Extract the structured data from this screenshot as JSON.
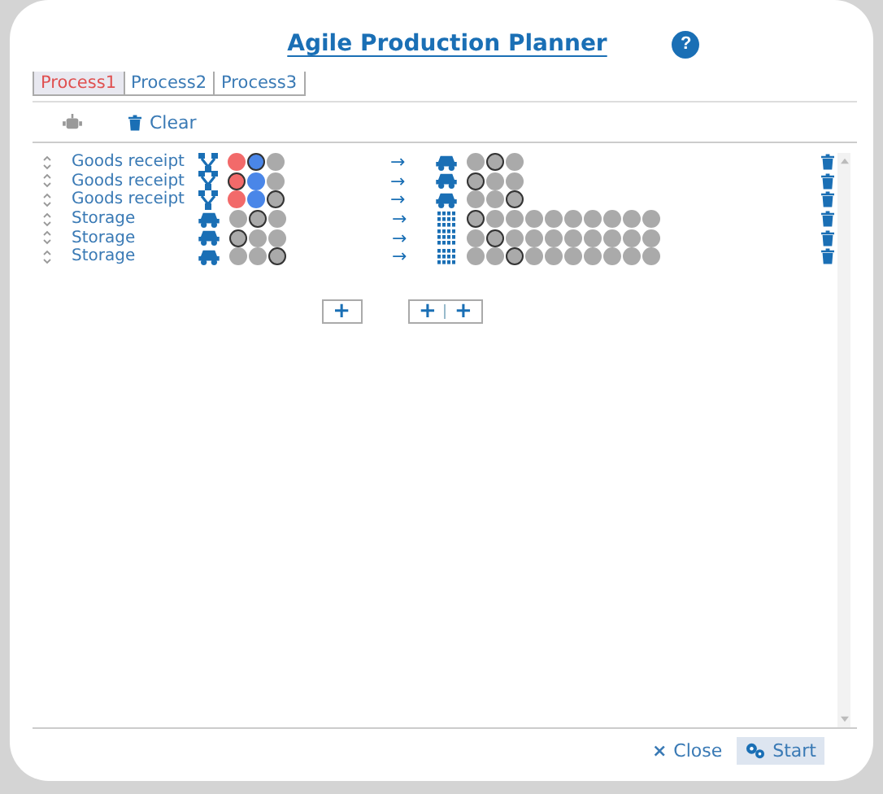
{
  "title": "Agile Production Planner",
  "help": "?",
  "tabs": [
    {
      "label": "Process1",
      "selected": true
    },
    {
      "label": "Process2",
      "selected": false
    },
    {
      "label": "Process3",
      "selected": false
    }
  ],
  "toolbar": {
    "clear": "Clear"
  },
  "rows": [
    {
      "name": "Goods receipt",
      "source": {
        "kind": "fork",
        "slots": [
          {
            "color": "#f26a6a",
            "selected": false
          },
          {
            "color": "#4a86e8",
            "selected": true
          },
          {
            "color": "#aaaaaa",
            "selected": false
          }
        ]
      },
      "arrow": "→",
      "target": {
        "kind": "car",
        "slots": [
          {
            "color": "#aaaaaa",
            "selected": false
          },
          {
            "color": "#aaaaaa",
            "selected": true
          },
          {
            "color": "#aaaaaa",
            "selected": false
          }
        ]
      }
    },
    {
      "name": "Goods receipt",
      "source": {
        "kind": "fork",
        "slots": [
          {
            "color": "#f26a6a",
            "selected": true
          },
          {
            "color": "#4a86e8",
            "selected": false
          },
          {
            "color": "#aaaaaa",
            "selected": false
          }
        ]
      },
      "arrow": "→",
      "target": {
        "kind": "car",
        "slots": [
          {
            "color": "#aaaaaa",
            "selected": true
          },
          {
            "color": "#aaaaaa",
            "selected": false
          },
          {
            "color": "#aaaaaa",
            "selected": false
          }
        ]
      }
    },
    {
      "name": "Goods receipt",
      "source": {
        "kind": "fork",
        "slots": [
          {
            "color": "#f26a6a",
            "selected": false
          },
          {
            "color": "#4a86e8",
            "selected": false
          },
          {
            "color": "#aaaaaa",
            "selected": true
          }
        ]
      },
      "arrow": "→",
      "target": {
        "kind": "car",
        "slots": [
          {
            "color": "#aaaaaa",
            "selected": false
          },
          {
            "color": "#aaaaaa",
            "selected": false
          },
          {
            "color": "#aaaaaa",
            "selected": true
          }
        ]
      }
    },
    {
      "name": "Storage",
      "source": {
        "kind": "car",
        "slots": [
          {
            "color": "#aaaaaa",
            "selected": false
          },
          {
            "color": "#aaaaaa",
            "selected": true
          },
          {
            "color": "#aaaaaa",
            "selected": false
          }
        ]
      },
      "arrow": "→",
      "target": {
        "kind": "grid",
        "slots": [
          {
            "color": "#aaaaaa",
            "selected": true
          },
          {
            "color": "#aaaaaa",
            "selected": false
          },
          {
            "color": "#aaaaaa",
            "selected": false
          },
          {
            "color": "#aaaaaa",
            "selected": false
          },
          {
            "color": "#aaaaaa",
            "selected": false
          },
          {
            "color": "#aaaaaa",
            "selected": false
          },
          {
            "color": "#aaaaaa",
            "selected": false
          },
          {
            "color": "#aaaaaa",
            "selected": false
          },
          {
            "color": "#aaaaaa",
            "selected": false
          },
          {
            "color": "#aaaaaa",
            "selected": false
          }
        ]
      }
    },
    {
      "name": "Storage",
      "source": {
        "kind": "car",
        "slots": [
          {
            "color": "#aaaaaa",
            "selected": true
          },
          {
            "color": "#aaaaaa",
            "selected": false
          },
          {
            "color": "#aaaaaa",
            "selected": false
          }
        ]
      },
      "arrow": "→",
      "target": {
        "kind": "grid",
        "slots": [
          {
            "color": "#aaaaaa",
            "selected": false
          },
          {
            "color": "#aaaaaa",
            "selected": true
          },
          {
            "color": "#aaaaaa",
            "selected": false
          },
          {
            "color": "#aaaaaa",
            "selected": false
          },
          {
            "color": "#aaaaaa",
            "selected": false
          },
          {
            "color": "#aaaaaa",
            "selected": false
          },
          {
            "color": "#aaaaaa",
            "selected": false
          },
          {
            "color": "#aaaaaa",
            "selected": false
          },
          {
            "color": "#aaaaaa",
            "selected": false
          },
          {
            "color": "#aaaaaa",
            "selected": false
          }
        ]
      }
    },
    {
      "name": "Storage",
      "source": {
        "kind": "car",
        "slots": [
          {
            "color": "#aaaaaa",
            "selected": false
          },
          {
            "color": "#aaaaaa",
            "selected": false
          },
          {
            "color": "#aaaaaa",
            "selected": true
          }
        ]
      },
      "arrow": "→",
      "target": {
        "kind": "grid",
        "slots": [
          {
            "color": "#aaaaaa",
            "selected": false
          },
          {
            "color": "#aaaaaa",
            "selected": false
          },
          {
            "color": "#aaaaaa",
            "selected": true
          },
          {
            "color": "#aaaaaa",
            "selected": false
          },
          {
            "color": "#aaaaaa",
            "selected": false
          },
          {
            "color": "#aaaaaa",
            "selected": false
          },
          {
            "color": "#aaaaaa",
            "selected": false
          },
          {
            "color": "#aaaaaa",
            "selected": false
          },
          {
            "color": "#aaaaaa",
            "selected": false
          },
          {
            "color": "#aaaaaa",
            "selected": false
          }
        ]
      }
    }
  ],
  "add_buttons": [
    {
      "labels": [
        "+"
      ]
    },
    {
      "labels": [
        "+",
        "+"
      ]
    }
  ],
  "footer": {
    "close_icon": "×",
    "close": "Close",
    "start": "Start"
  }
}
